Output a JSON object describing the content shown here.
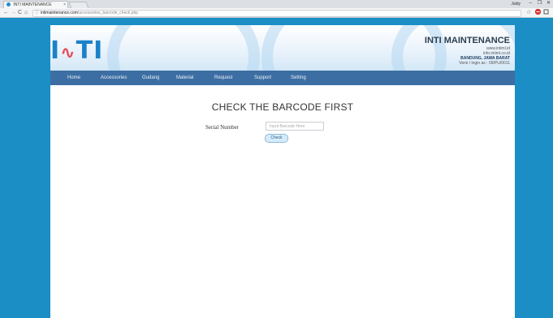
{
  "browser": {
    "tab_title": "INTI MAINTENANCE",
    "tab_close": "×",
    "user": "Jaldy",
    "minimize": "–",
    "maximize": "❐",
    "close": "✕",
    "nav": {
      "back": "←",
      "forward": "→",
      "reload": "C",
      "home": "⌂"
    },
    "url": {
      "info": "ⓘ",
      "domain": "intimaintenance.com",
      "path": "/accessories_barcode_check.php"
    },
    "star": "☆"
  },
  "site": {
    "logo": {
      "part1": "I",
      "part2": "∿",
      "part3": "TI"
    },
    "company": {
      "name": "INTI MAINTENANCE",
      "line1": "www.intiml.id",
      "line2": "info.intiml.co.id",
      "city": "BANDUNG, JAWA BARAT",
      "version": "Versi / login as : 09/PU/0011"
    },
    "menu": [
      "Home",
      "Accessories",
      "Gudang",
      "Material",
      "Request",
      "Support",
      "Setting"
    ]
  },
  "form": {
    "heading": "CHECK THE BARCODE FIRST",
    "serial_label": "Serial Number",
    "serial_placeholder": "Input Barcode Here",
    "check_label": "Check"
  },
  "colors": {
    "accent": "#3d6ea3",
    "background": "#1a8ec5"
  }
}
